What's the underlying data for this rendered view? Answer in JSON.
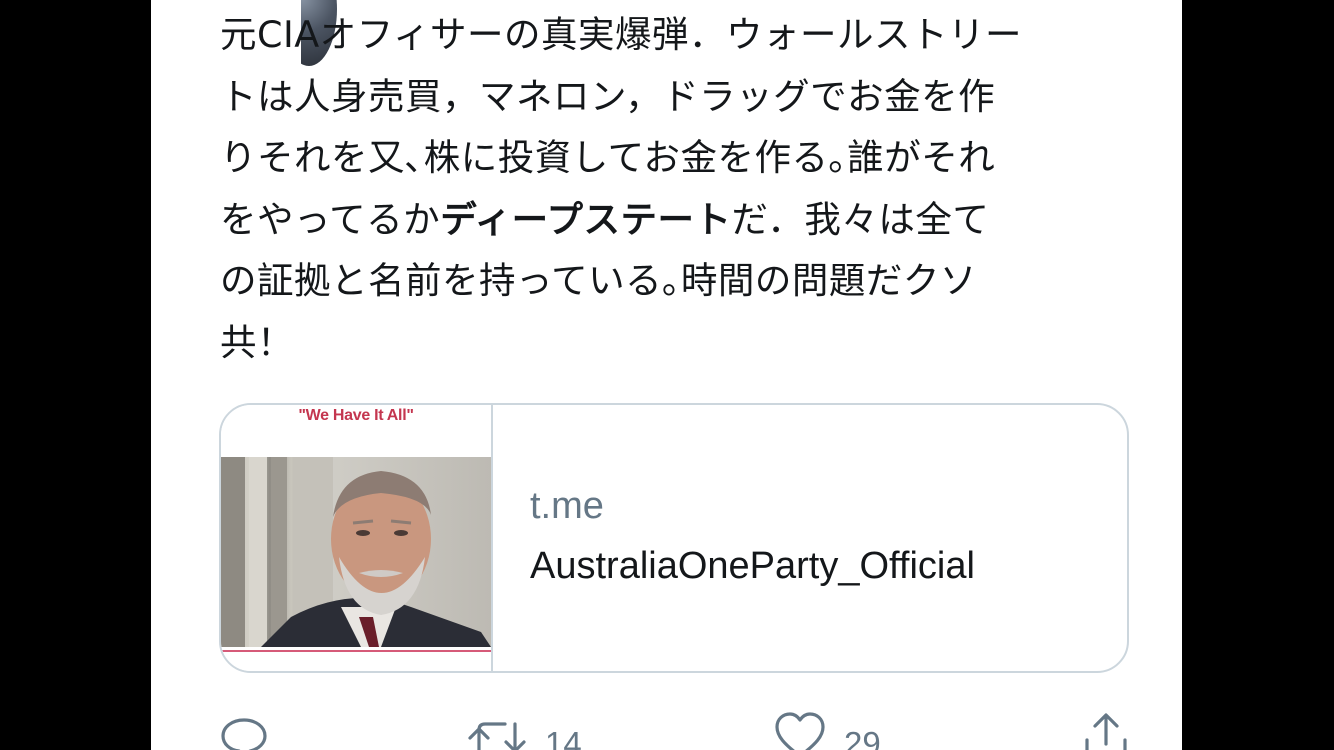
{
  "tweet": {
    "text_lines": [
      "元CIAオフィサーの真実爆弾．ウォールストリー",
      "トは人身売買，マネロン，ドラッグでお金を作",
      "りそれを又､株に投資してお金を作る｡誰がそれ",
      "をやってるか",
      "ディープステート",
      "だ．我々は全て",
      "の証拠と名前を持っている｡時間の問題だクソ",
      "共！"
    ]
  },
  "link_card": {
    "thumbnail_caption": "\"We Have It All\"",
    "domain": "t.me",
    "title": "AustraliaOneParty_Official"
  },
  "actions": {
    "reply_icon": "reply-icon",
    "retweet_icon": "retweet-icon",
    "retweet_count": "14",
    "like_icon": "heart-icon",
    "like_count": "29",
    "share_icon": "share-icon"
  },
  "colors": {
    "text": "#14171a",
    "secondary": "#657786",
    "border": "#ccd6dd",
    "caption": "#c4364f"
  }
}
